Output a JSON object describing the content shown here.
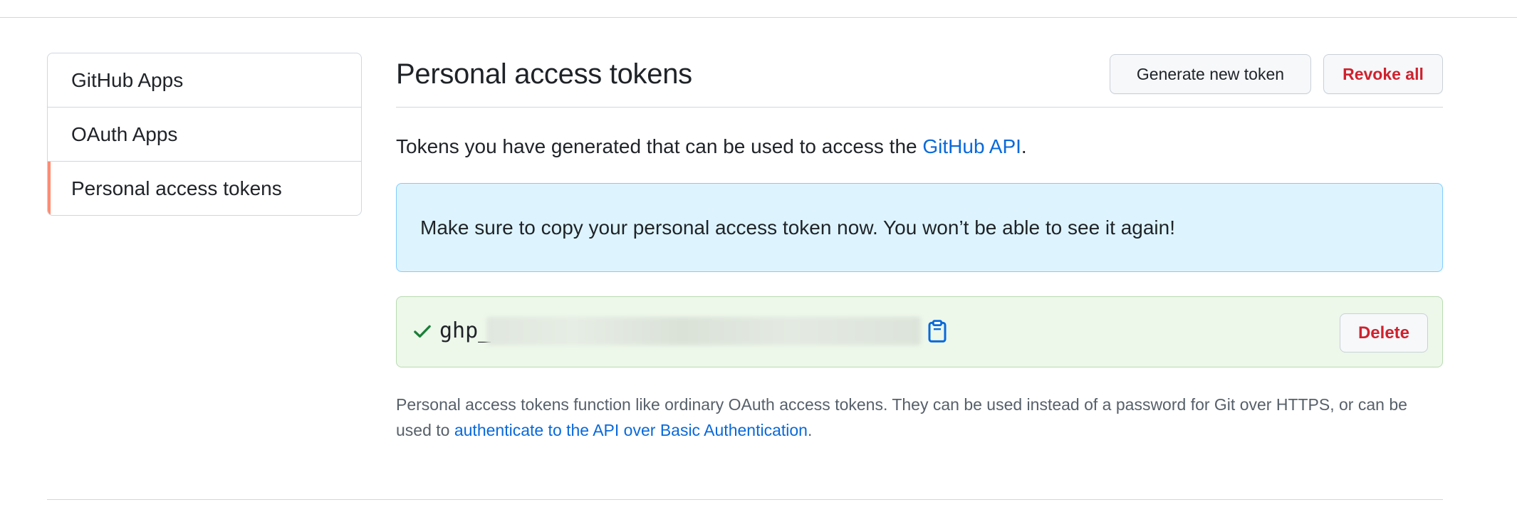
{
  "sidebar": {
    "items": [
      {
        "label": "GitHub Apps"
      },
      {
        "label": "OAuth Apps"
      },
      {
        "label": "Personal access tokens"
      }
    ],
    "selected_accent": "#fd8c73"
  },
  "header": {
    "title": "Personal access tokens",
    "generate_label": "Generate new token",
    "revoke_label": "Revoke all"
  },
  "intro": {
    "text_before": "Tokens you have generated that can be used to access the ",
    "link_text": "GitHub API",
    "text_after": "."
  },
  "flash": {
    "message": "Make sure to copy your personal access token now. You won’t be able to see it again!"
  },
  "token": {
    "prefix": "ghp_",
    "icons": {
      "status": "check-icon",
      "copy": "clipboard-icon"
    },
    "delete_label": "Delete"
  },
  "footnote": {
    "text_before": "Personal access tokens function like ordinary OAuth access tokens. They can be used instead of a password for Git over HTTPS, or can be used to ",
    "link_text": "authenticate to the API over Basic Authentication",
    "text_after": "."
  },
  "colors": {
    "link": "#0969da",
    "danger": "#cf222e",
    "success": "#1a7f37",
    "info_bg": "#ddf4ff",
    "success_bg": "#edf7ea"
  }
}
